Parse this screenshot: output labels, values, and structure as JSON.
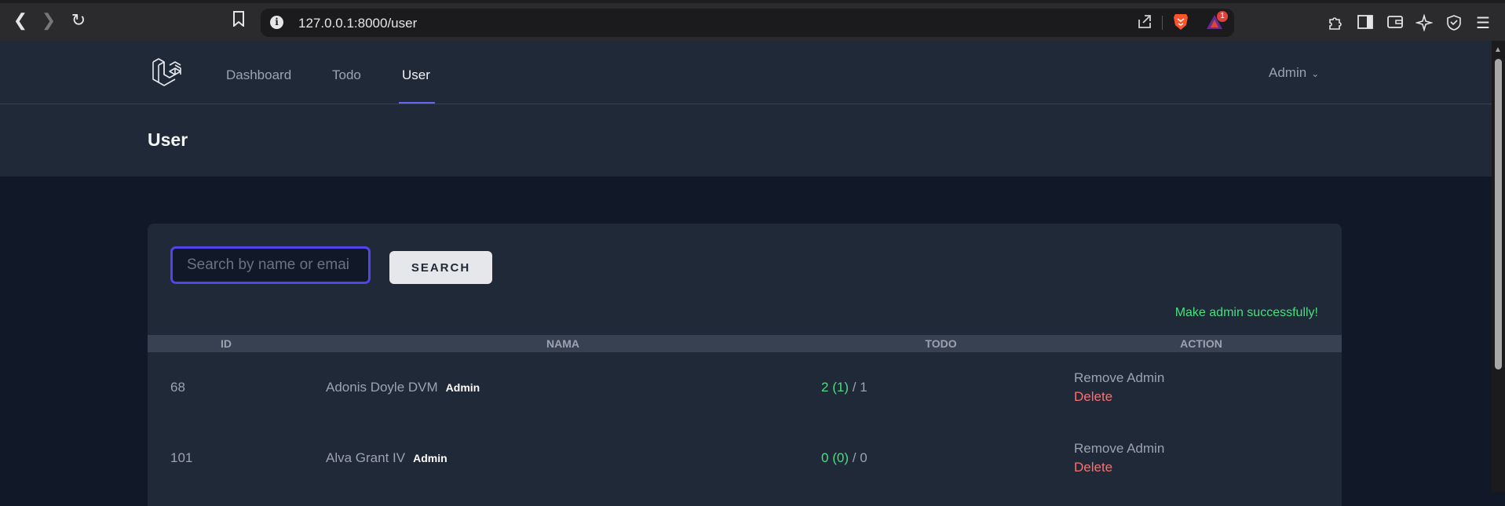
{
  "browser": {
    "url": "127.0.0.1:8000/user",
    "rewards_badge": "1"
  },
  "nav": {
    "links": [
      "Dashboard",
      "Todo",
      "User"
    ],
    "active": "User",
    "user_menu": "Admin"
  },
  "header": {
    "title": "User"
  },
  "search": {
    "placeholder": "Search by name or emai",
    "value": "",
    "button_label": "SEARCH"
  },
  "flash_message": "Make admin successfully!",
  "table": {
    "headers": [
      "ID",
      "NAMA",
      "TODO",
      "ACTION"
    ],
    "rows": [
      {
        "id": "68",
        "name": "Adonis Doyle DVM",
        "badge": "Admin",
        "todo_a": "2",
        "todo_b": "(1)",
        "todo_sep": "/",
        "todo_c": "1",
        "action_1": "Remove Admin",
        "action_2": "Delete"
      },
      {
        "id": "101",
        "name": "Alva Grant IV",
        "badge": "Admin",
        "todo_a": "0",
        "todo_b": "(0)",
        "todo_sep": "/",
        "todo_c": "0",
        "action_1": "Remove Admin",
        "action_2": "Delete"
      }
    ]
  },
  "colors": {
    "accent": "#6366f1",
    "success": "#4ade80",
    "danger": "#f87171",
    "background": "#111827",
    "panel": "#1f2937"
  },
  "icons": {
    "back": "back-arrow-icon",
    "forward": "forward-arrow-icon",
    "reload": "reload-icon",
    "bookmark": "bookmark-icon",
    "site_info": "info-icon",
    "share": "share-icon",
    "brave": "brave-lion-icon",
    "rewards": "rewards-triangle-icon",
    "extensions": "puzzle-icon",
    "sidebar": "sidebar-icon",
    "wallet": "wallet-icon",
    "leo": "sparkle-icon",
    "vpn": "shield-icon",
    "menu": "hamburger-menu-icon",
    "logo": "laravel-logo-icon",
    "chevron": "chevron-down-icon"
  }
}
